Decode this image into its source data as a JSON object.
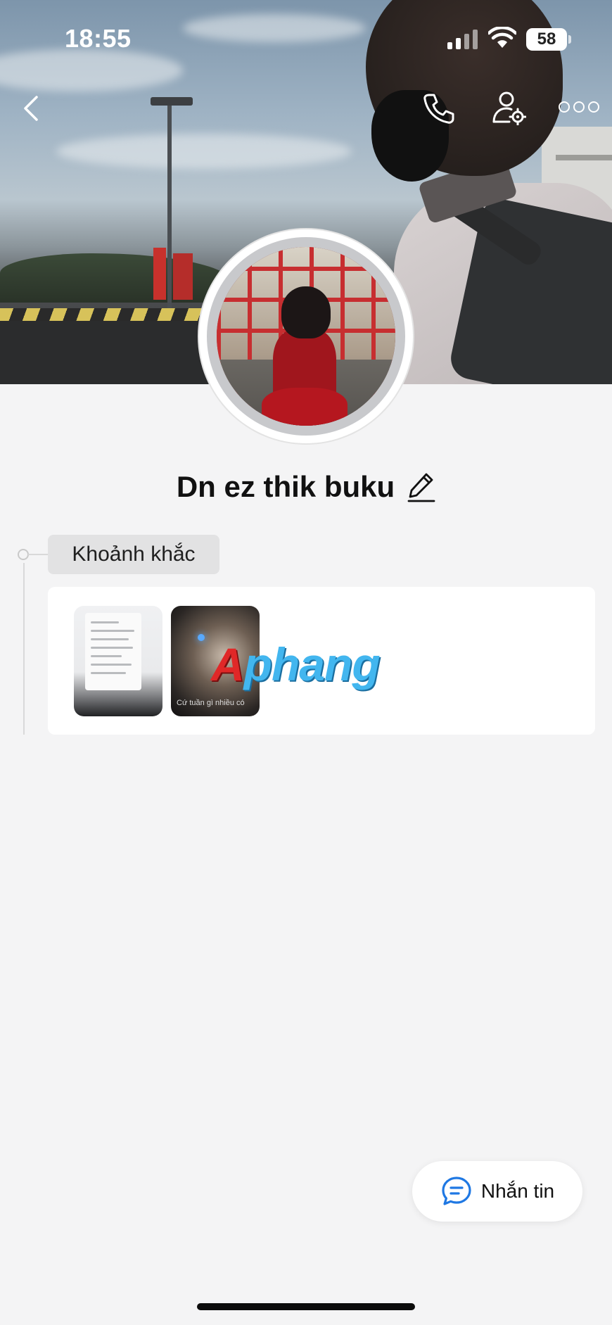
{
  "status_bar": {
    "time": "18:55",
    "battery": "58"
  },
  "profile": {
    "name": "Dn ez thik buku"
  },
  "timeline": {
    "section_label": "Khoảnh khắc",
    "moments": [
      {
        "caption": ""
      },
      {
        "caption": "Cứ tuần gì nhiều có"
      }
    ]
  },
  "watermark": {
    "prefix": "A",
    "text": "phang"
  },
  "actions": {
    "message_label": "Nhắn tin"
  },
  "icons": [
    "back-icon",
    "phone-icon",
    "user-settings-icon",
    "more-icon",
    "edit-icon",
    "chat-bubble-icon"
  ]
}
